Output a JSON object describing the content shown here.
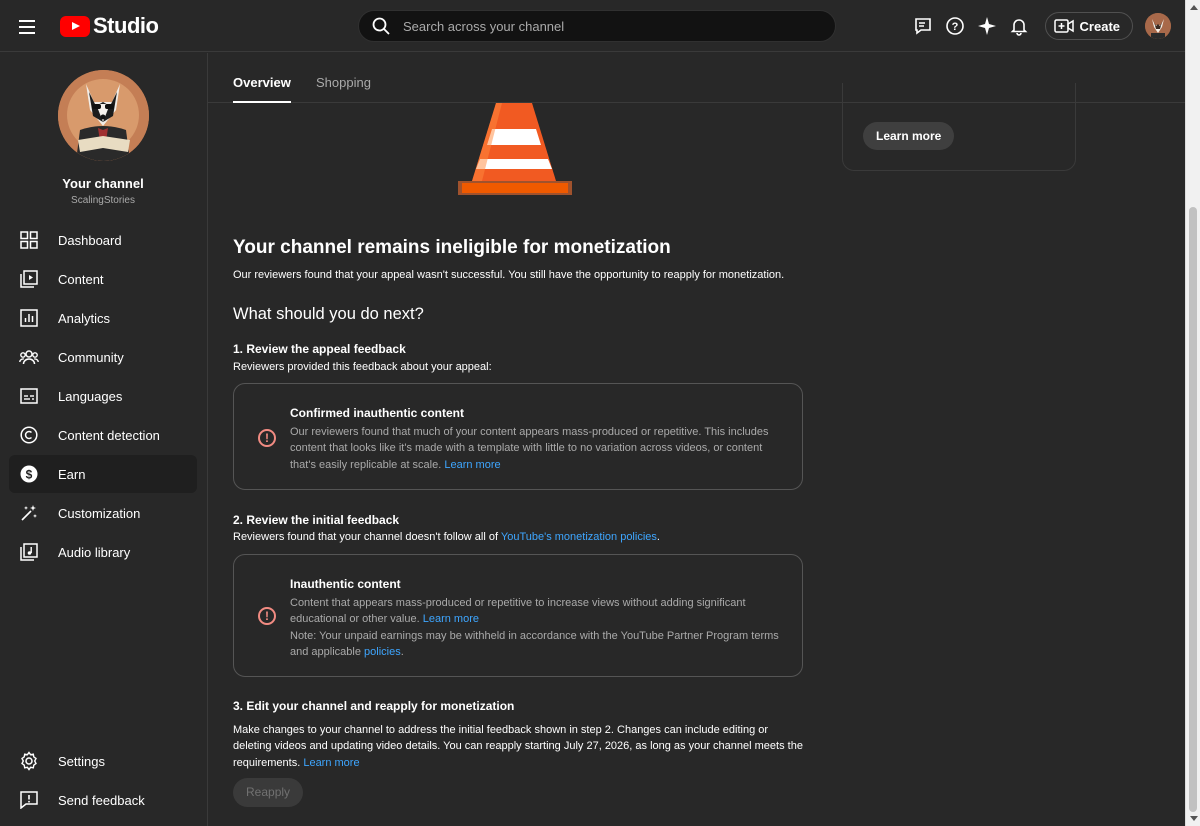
{
  "app": {
    "logo_text": "Studio",
    "brand_color": "#ff0000"
  },
  "search": {
    "placeholder": "Search across your channel"
  },
  "header": {
    "create_label": "Create"
  },
  "channel": {
    "name": "Your channel",
    "handle": "ScalingStories"
  },
  "sidebar": {
    "items": [
      {
        "label": "Dashboard",
        "icon": "dashboard-icon"
      },
      {
        "label": "Content",
        "icon": "content-icon"
      },
      {
        "label": "Analytics",
        "icon": "analytics-icon"
      },
      {
        "label": "Community",
        "icon": "community-icon"
      },
      {
        "label": "Languages",
        "icon": "languages-icon"
      },
      {
        "label": "Content detection",
        "icon": "content-detection-icon"
      },
      {
        "label": "Earn",
        "icon": "earn-icon",
        "active": true
      },
      {
        "label": "Customization",
        "icon": "customization-icon"
      },
      {
        "label": "Audio library",
        "icon": "audio-library-icon"
      }
    ],
    "bottom": [
      {
        "label": "Settings",
        "icon": "settings-icon"
      },
      {
        "label": "Send feedback",
        "icon": "feedback-icon"
      }
    ]
  },
  "tabs": [
    {
      "label": "Overview",
      "active": true
    },
    {
      "label": "Shopping",
      "active": false
    }
  ],
  "side_card": {
    "learn_more": "Learn more"
  },
  "main": {
    "title": "Your channel remains ineligible for monetization",
    "subtitle": "Our reviewers found that your appeal wasn't successful. You still have the opportunity to reapply for monetization.",
    "next_heading": "What should you do next?",
    "step1": {
      "title": "1. Review the appeal feedback",
      "text": "Reviewers provided this feedback about your appeal:",
      "card": {
        "title": "Confirmed inauthentic content",
        "body": "Our reviewers found that much of your content appears mass-produced or repetitive. This includes content that looks like it's made with a template with little to no variation across videos, or content that's easily replicable at scale.",
        "link": "Learn more"
      }
    },
    "step2": {
      "title": "2. Review the initial feedback",
      "text_before": "Reviewers found that your channel doesn't follow all of ",
      "link": "YouTube's monetization policies",
      "text_after": ".",
      "card": {
        "title": "Inauthentic content",
        "body": "Content that appears mass-produced or repetitive to increase views without adding significant educational or other value.",
        "link": "Learn more",
        "note": "Note: Your unpaid earnings may be withheld in accordance with the YouTube Partner Program terms and applicable",
        "note_link": "policies",
        "note_end": "."
      }
    },
    "step3": {
      "title": "3. Edit your channel and reapply for monetization",
      "text": "Make changes to your channel to address the initial feedback shown in step 2. Changes can include editing or deleting videos and updating video details. You can reapply starting July 27, 2026, as long as your channel meets the requirements.",
      "link": "Learn more"
    },
    "reapply_label": "Reapply"
  },
  "colors": {
    "background": "#282828",
    "link": "#3ea6ff",
    "warning": "#f28b82"
  }
}
